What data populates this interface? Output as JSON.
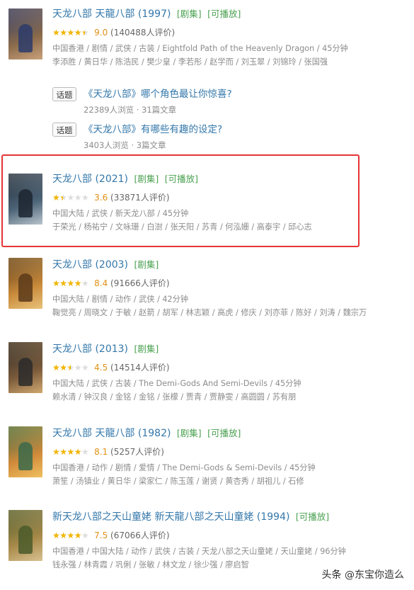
{
  "results": [
    {
      "title": "天龙八部 天龍八部 (1997)",
      "tags": [
        "[剧集]",
        "[可播放]"
      ],
      "rating_stars": 4.5,
      "score": "9.0",
      "votes": "(140488人评价)",
      "meta1": "中国香港 / 剧情 / 武侠 / 古装 / Eightfold Path of the Heavenly Dragon / 45分钟",
      "meta2": "李添胜 / 黄日华 / 陈浩民 / 樊少皇 / 李若彤 / 赵学而 / 刘玉翠 / 刘锦玲 / 张国强",
      "poster_colors": [
        "#2b3b6b",
        "#8a6a4a",
        "#c9a07a"
      ]
    },
    {
      "title": "天龙八部 (2021)",
      "tags": [
        "[剧集]",
        "[可播放]"
      ],
      "rating_stars": 1.5,
      "score": "3.6",
      "votes": "(33871人评价)",
      "meta1": "中国大陆 / 武侠 / 新天龙八部 / 45分钟",
      "meta2": "于荣光 / 杨祐宁 / 文咏珊 / 白澍 / 张天阳 / 苏青 / 何泓姗 / 高泰宇 / 邱心志",
      "poster_colors": [
        "#1c2530",
        "#4d6578",
        "#b9c4cc"
      ]
    },
    {
      "title": "天龙八部 (2003)",
      "tags": [
        "[剧集]"
      ],
      "rating_stars": 4,
      "score": "8.4",
      "votes": "(91666人评价)",
      "meta1": "中国大陆 / 剧情 / 动作 / 武侠 / 42分钟",
      "meta2": "鞠觉亮 / 周晓文 / 于敏 / 赵箭 / 胡军 / 林志颖 / 高虎 / 修庆 / 刘亦菲 / 陈好 / 刘涛 / 魏宗万",
      "poster_colors": [
        "#5a3a1a",
        "#c98a3a",
        "#e8c27a"
      ]
    },
    {
      "title": "天龙八部 (2013)",
      "tags": [
        "[剧集]"
      ],
      "rating_stars": 2.5,
      "score": "4.5",
      "votes": "(14514人评价)",
      "meta1": "中国大陆 / 武侠 / 古装 / The Demi-Gods And Semi-Devils / 45分钟",
      "meta2": "赖水清 / 钟汉良 / 金铭 / 金铭 / 张檬 / 贾青 / 贾静雯 / 高圆圆 / 苏有朋",
      "poster_colors": [
        "#2a2a2a",
        "#7a5a3a",
        "#d0a870"
      ]
    },
    {
      "title": "天龙八部 天龍八部 (1982)",
      "tags": [
        "[剧集]",
        "[可播放]"
      ],
      "rating_stars": 4,
      "score": "8.1",
      "votes": "(5257人评价)",
      "meta1": "中国香港 / 动作 / 剧情 / 爱情 / The Demi-Gods & Semi-Devils / 45分钟",
      "meta2": "萧笙 / 汤镇业 / 黄日华 / 梁家仁 / 陈玉莲 / 谢贤 / 黄杏秀 / 胡祖儿 / 石修",
      "poster_colors": [
        "#3a6a4a",
        "#d08a3a",
        "#f0c060"
      ]
    },
    {
      "title": "新天龙八部之天山童姥 新天龍八部之天山童姥 (1994)",
      "tags": [
        "[可播放]"
      ],
      "rating_stars": 4,
      "score": "7.5",
      "votes": "(67066人评价)",
      "meta1": "中国香港 / 中国大陆 / 动作 / 武侠 / 古装 / 天龙八部之天山童姥 / 天山童姥 / 96分钟",
      "meta2": "钱永强 / 林青霞 / 巩俐 / 张敏 / 林文龙 / 徐少强 / 廖启智",
      "poster_colors": [
        "#4a5a2a",
        "#a88a4a",
        "#d8c090"
      ]
    }
  ],
  "topics": [
    {
      "badge": "话题",
      "question": "《天龙八部》哪个角色最让你惊喜?",
      "stats": "22389人浏览 · 31篇文章"
    },
    {
      "badge": "话题",
      "question": "《天龙八部》有哪些有趣的设定?",
      "stats": "3403人浏览 · 3篇文章"
    }
  ],
  "watermark": {
    "prefix": "头条",
    "handle": "@东宝你造么"
  },
  "colors": {
    "link": "#3377aa",
    "tag": "#4aa150",
    "star": "#f2b500",
    "score": "#e09015",
    "highlight": "#e63436"
  }
}
